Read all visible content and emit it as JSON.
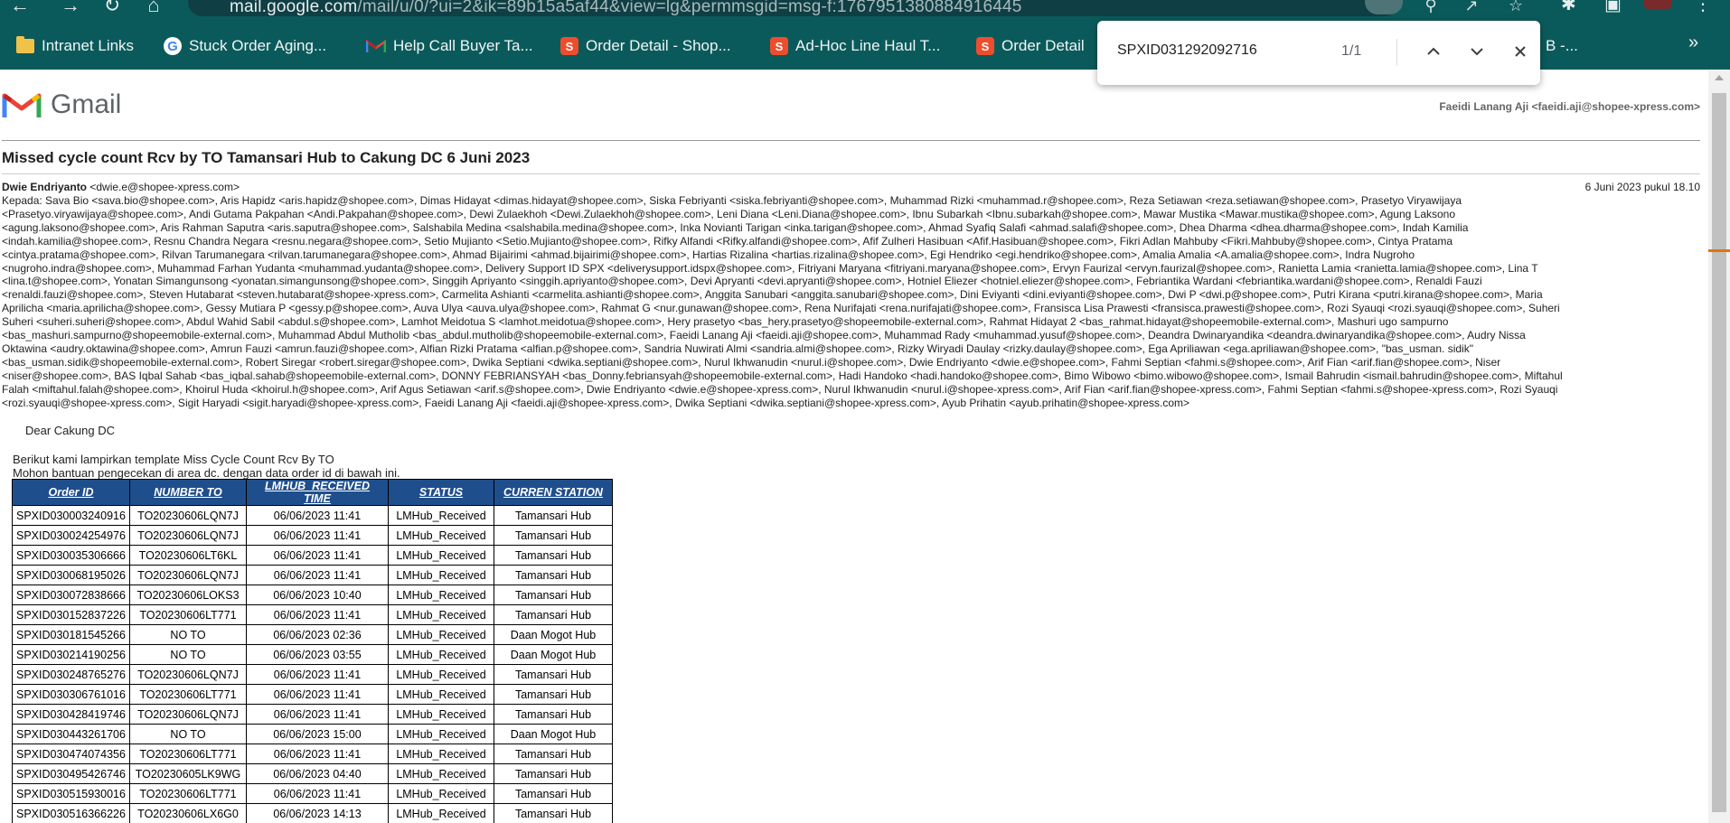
{
  "browser": {
    "url_prefix": "mail.google.com",
    "url_rest": "/mail/u/0/?ui=2&ik=89b15a5af44&view=lg&permmsgid=msg-f:1767951380884916445",
    "bookmarks": [
      {
        "icon": "folder-icon",
        "label": "Intranet Links"
      },
      {
        "icon": "google-icon",
        "label": "Stuck Order Aging..."
      },
      {
        "icon": "gmail-icon",
        "label": "Help Call Buyer Ta..."
      },
      {
        "icon": "shopee-icon",
        "label": "Order Detail - Shop..."
      },
      {
        "icon": "shopee-icon",
        "label": "Ad-Hoc Line Haul T..."
      },
      {
        "icon": "shopee-icon",
        "label": "Order Detail"
      },
      {
        "icon": "shopee-icon",
        "label": "B -..."
      }
    ],
    "bookmarks_more": "»"
  },
  "find_bar": {
    "query": "SPXID031292092716",
    "count": "1/1"
  },
  "gmail": {
    "wordmark": "Gmail",
    "account": "Faeidi Lanang Aji <faeidi.aji@shopee-xpress.com>",
    "subject": "Missed cycle count Rcv by TO Tamansari Hub to Cakung DC 6 Juni 2023",
    "sender_name": "Dwie Endriyanto",
    "sender_email": "<dwie.e@shopee-xpress.com>",
    "sent_date": "6 Juni 2023 pukul 18.10",
    "recipient_lines": [
      "Kepada: Sava Bio <sava.bio@shopee.com>, Aris Hapidz <aris.hapidz@shopee.com>, Dimas Hidayat <dimas.hidayat@shopee.com>, Siska Febriyanti <siska.febriyanti@shopee.com>, Muhammad Rizki <muhammad.r@shopee.com>, Reza Setiawan <reza.setiawan@shopee.com>, Prasetyo Viryawijaya",
      "<Prasetyo.viryawijaya@shopee.com>, Andi Gutama Pakpahan <Andi.Pakpahan@shopee.com>, Dewi Zulaekhoh <Dewi.Zulaekhoh@shopee.com>, Leni Diana <Leni.Diana@shopee.com>, Ibnu Subarkah <Ibnu.subarkah@shopee.com>, Mawar Mustika <Mawar.mustika@shopee.com>, Agung Laksono",
      "<agung.laksono@shopee.com>, Aris Rahman Saputra <aris.saputra@shopee.com>, Salshabila Medina <salshabila.medina@shopee.com>, Inka Novianti Tarigan <inka.tarigan@shopee.com>, Ahmad Syafiq Salafi <ahmad.salafi@shopee.com>, Dhea Dharma <dhea.dharma@shopee.com>, Indah Kamilia",
      "<indah.kamilia@shopee.com>, Resnu Chandra Negara <resnu.negara@shopee.com>, Setio Mujianto <Setio.Mujianto@shopee.com>, Rifky Alfandi <Rifky.alfandi@shopee.com>, Afif Zulheri Hasibuan <Afif.Hasibuan@shopee.com>, Fikri Adlan Mahbuby <Fikri.Mahbuby@shopee.com>, Cintya Pratama",
      "<cintya.pratama@shopee.com>, Rilvan Tarumanegara <rilvan.tarumanegara@shopee.com>, Ahmad Bijairimi <ahmad.bijairimi@shopee.com>, Hartias Rizalina <hartias.rizalina@shopee.com>, Egi Hendriko <egi.hendriko@shopee.com>, Amalia Amalia <A.amalia@shopee.com>, Indra Nugroho",
      "<nugroho.indra@shopee.com>, Muhammad Farhan Yudanta <muhammad.yudanta@shopee.com>, Delivery Support ID SPX <deliverysupport.idspx@shopee.com>, Fitriyani Maryana <fitriyani.maryana@shopee.com>, Ervyn Faurizal <ervyn.faurizal@shopee.com>, Ranietta Lamia <ranietta.lamia@shopee.com>, Lina T",
      "<lina.t@shopee.com>, Yonatan Simangunsong <yonatan.simangunsong@shopee.com>, Singgih Apriyanto <singgih.apriyanto@shopee.com>, Devi Apryanti <devi.apryanti@shopee.com>, Hotniel Eliezer <hotniel.eliezer@shopee.com>, Febriantika Wardani <febriantika.wardani@shopee.com>, Renaldi Fauzi",
      "<renaldi.fauzi@shopee.com>, Steven Hutabarat <steven.hutabarat@shopee-xpress.com>, Carmelita Ashianti <carmelita.ashianti@shopee.com>, Anggita Sanubari <anggita.sanubari@shopee.com>, Dini Eviyanti <dini.eviyanti@shopee.com>, Dwi P <dwi.p@shopee.com>, Putri Kirana <putri.kirana@shopee.com>, Maria",
      "Aprilicha <maria.aprilicha@shopee.com>, Gessy Mutiara P <gessy.p@shopee.com>, Auva Ulya <auva.ulya@shopee.com>, Rahmat G <nur.gunawan@shopee.com>, Rena Nurifajati <rena.nurifajati@shopee.com>, Fransisca Lisa Prawesti <fransisca.prawesti@shopee.com>, Rozi Syauqi <rozi.syauqi@shopee.com>, Suheri",
      "Suheri <suheri.suheri@shopee.com>, Abdul Wahid Sabil <abdul.s@shopee.com>, Lamhot Meidotua S <lamhot.meidotua@shopee.com>, Hery prasetyo <bas_hery.prasetyo@shopeemobile-external.com>, Rahmat Hidayat 2 <bas_rahmat.hidayat@shopeemobile-external.com>, Mashuri ugo sampurno",
      "<bas_mashuri.sampurno@shopeemobile-external.com>, Muhammad Abdul Mutholib <bas_abdul.mutholib@shopeemobile-external.com>, Faeidi Lanang Aji <faeidi.aji@shopee.com>, Muhammad Rady <muhammad.yusuf@shopee.com>, Deandra Dwinaryandika <deandra.dwinaryandika@shopee.com>, Audry Nissa",
      "Oktawina <audry.oktawina@shopee.com>, Amrun Fauzi <amrun.fauzi@shopee.com>, Alfian Rizki Pratama <alfian.p@shopee.com>, Sandria Nuwirati Almi <sandria.almi@shopee.com>, Rizky Wiryadi Daulay <rizky.daulay@shopee.com>, Ega Apriliawan <ega.apriliawan@shopee.com>, \"bas_usman. sidik\"",
      "<bas_usman.sidik@shopeemobile-external.com>, Robert Siregar <robert.siregar@shopee.com>, Dwika Septiani <dwika.septiani@shopee.com>, Nurul Ikhwanudin <nurul.i@shopee.com>, Dwie Endriyanto <dwie.e@shopee.com>, Fahmi Septian <fahmi.s@shopee.com>, Arif Fian <arif.fian@shopee.com>, Niser",
      "<niser@shopee.com>, BAS Iqbal Sahab <bas_iqbal.sahab@shopeemobile-external.com>, DONNY FEBRIANSYAH <bas_Donny.febriansyah@shopeemobile-external.com>, Hadi Handoko <hadi.handoko@shopee.com>, Bimo Wibowo <bimo.wibowo@shopee.com>, Ismail Bahrudin <ismail.bahrudin@shopee.com>, Miftahul",
      "Falah <miftahul.falah@shopee.com>, Khoirul Huda <khoirul.h@shopee.com>, Arif Agus Setiawan <arif.s@shopee.com>, Dwie Endriyanto <dwie.e@shopee-xpress.com>, Nurul Ikhwanudin <nurul.i@shopee-xpress.com>, Arif Fian <arif.fian@shopee-xpress.com>, Fahmi Septian <fahmi.s@shopee-xpress.com>, Rozi Syauqi",
      "<rozi.syauqi@shopee-xpress.com>, Sigit Haryadi <sigit.haryadi@shopee-xpress.com>, Faeidi Lanang Aji <faeidi.aji@shopee-xpress.com>, Dwika Septiani <dwika.septiani@shopee-xpress.com>, Ayub Prihatin <ayub.prihatin@shopee-xpress.com>"
    ],
    "greeting": "Dear Cakung DC",
    "intro_line1": "Berikut kami lampirkan template Miss Cycle Count Rcv By TO",
    "intro_line2": "Mohon bantuan pengecekan di area dc. dengan data order id di bawah ini."
  },
  "table": {
    "headers": [
      "Order ID",
      "NUMBER TO",
      "LMHUB_RECEIVED TIME",
      "STATUS",
      "CURREN STATION"
    ],
    "rows": [
      [
        "SPXID030003240916",
        "TO20230606LQN7J",
        "06/06/2023 11:41",
        "LMHub_Received",
        "Tamansari Hub"
      ],
      [
        "SPXID030024254976",
        "TO20230606LQN7J",
        "06/06/2023 11:41",
        "LMHub_Received",
        "Tamansari Hub"
      ],
      [
        "SPXID030035306666",
        "TO20230606LT6KL",
        "06/06/2023 11:41",
        "LMHub_Received",
        "Tamansari Hub"
      ],
      [
        "SPXID030068195026",
        "TO20230606LQN7J",
        "06/06/2023 11:41",
        "LMHub_Received",
        "Tamansari Hub"
      ],
      [
        "SPXID030072838666",
        "TO20230606LOKS3",
        "06/06/2023 10:40",
        "LMHub_Received",
        "Tamansari Hub"
      ],
      [
        "SPXID030152837226",
        "TO20230606LT771",
        "06/06/2023 11:41",
        "LMHub_Received",
        "Tamansari Hub"
      ],
      [
        "SPXID030181545266",
        "NO TO",
        "06/06/2023 02:36",
        "LMHub_Received",
        "Daan Mogot Hub"
      ],
      [
        "SPXID030214190256",
        "NO TO",
        "06/06/2023 03:55",
        "LMHub_Received",
        "Daan Mogot Hub"
      ],
      [
        "SPXID030248765276",
        "TO20230606LQN7J",
        "06/06/2023 11:41",
        "LMHub_Received",
        "Tamansari Hub"
      ],
      [
        "SPXID030306761016",
        "TO20230606LT771",
        "06/06/2023 11:41",
        "LMHub_Received",
        "Tamansari Hub"
      ],
      [
        "SPXID030428419746",
        "TO20230606LQN7J",
        "06/06/2023 11:41",
        "LMHub_Received",
        "Tamansari Hub"
      ],
      [
        "SPXID030443261706",
        "NO TO",
        "06/06/2023 15:00",
        "LMHub_Received",
        "Daan Mogot Hub"
      ],
      [
        "SPXID030474074356",
        "TO20230606LT771",
        "06/06/2023 11:41",
        "LMHub_Received",
        "Tamansari Hub"
      ],
      [
        "SPXID030495426746",
        "TO20230605LK9WG",
        "06/06/2023 04:40",
        "LMHub_Received",
        "Tamansari Hub"
      ],
      [
        "SPXID030515930016",
        "TO20230606LT771",
        "06/06/2023 11:41",
        "LMHub_Received",
        "Tamansari Hub"
      ],
      [
        "SPXID030516366226",
        "TO20230606LX6G0",
        "06/06/2023 14:13",
        "LMHub_Received",
        "Tamansari Hub"
      ],
      [
        "",
        "",
        "",
        "",
        ""
      ]
    ]
  },
  "colors": {
    "chrome_bg": "#0b5a5b",
    "table_header_bg": "#1f4e8c",
    "scroll_marker": "#e37400"
  }
}
